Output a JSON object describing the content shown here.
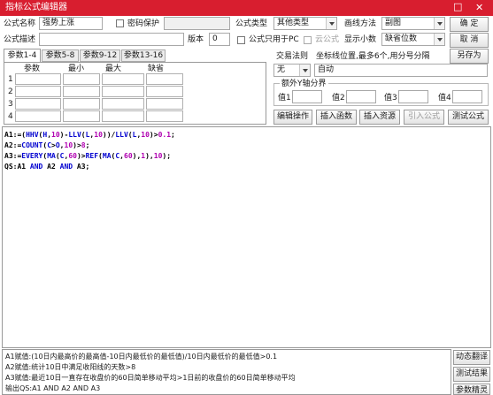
{
  "window": {
    "title": "指标公式编辑器",
    "min_glyph": "□",
    "close_glyph": "✕"
  },
  "header": {
    "name_label": "公式名称",
    "name_value": "强势上涨",
    "password_label": "密码保护",
    "type_label": "公式类型",
    "type_value": "其他类型",
    "draw_label": "画线方法",
    "draw_value": "副图",
    "desc_label": "公式描述",
    "desc_value": "",
    "version_label": "版本",
    "version_value": "0",
    "pc_only_label": "公式只用于PC",
    "cloud_label": "云公式",
    "decimals_label": "显示小数",
    "decimals_value": "缺省位数",
    "ok_label": "确 定",
    "cancel_label": "取 消",
    "saveas_label": "另存为"
  },
  "params": {
    "tabs": [
      "参数1-4",
      "参数5-8",
      "参数9-12",
      "参数13-16"
    ],
    "columns": [
      "参数",
      "最小",
      "最大",
      "缺省"
    ],
    "rows": [
      "1",
      "2",
      "3",
      "4"
    ]
  },
  "trade": {
    "rule_label": "交易法则",
    "rule_value": "无"
  },
  "coords": {
    "label": "坐标线位置,最多6个,用分号分隔",
    "value": "自动"
  },
  "yaxis": {
    "label": "额外Y轴分界",
    "fields": [
      "值1",
      "值2",
      "值3",
      "值4"
    ]
  },
  "actions": [
    "编辑操作",
    "插入函数",
    "插入资源",
    "引入公式",
    "测试公式"
  ],
  "code_lines": [
    [
      [
        "A1:=(",
        "o"
      ],
      [
        "HHV",
        "f"
      ],
      [
        "(",
        "o"
      ],
      [
        "H",
        "f"
      ],
      [
        ",",
        "o"
      ],
      [
        "10",
        "n"
      ],
      [
        ")-",
        "o"
      ],
      [
        "LLV",
        "f"
      ],
      [
        "(",
        "o"
      ],
      [
        "L",
        "f"
      ],
      [
        ",",
        "o"
      ],
      [
        "10",
        "n"
      ],
      [
        "))/",
        "o"
      ],
      [
        "LLV",
        "f"
      ],
      [
        "(",
        "o"
      ],
      [
        "L",
        "f"
      ],
      [
        ",",
        "o"
      ],
      [
        "10",
        "n"
      ],
      [
        ")>",
        "o"
      ],
      [
        "0.1",
        "n"
      ],
      [
        ";",
        "o"
      ]
    ],
    [
      [
        "A2:=",
        "o"
      ],
      [
        "COUNT",
        "f"
      ],
      [
        "(",
        "o"
      ],
      [
        "C",
        "f"
      ],
      [
        ">",
        "o"
      ],
      [
        "O",
        "f"
      ],
      [
        ",",
        "o"
      ],
      [
        "10",
        "n"
      ],
      [
        ")>",
        "o"
      ],
      [
        "8",
        "n"
      ],
      [
        ";",
        "o"
      ]
    ],
    [
      [
        "A3:=",
        "o"
      ],
      [
        "EVERY",
        "f"
      ],
      [
        "(",
        "o"
      ],
      [
        "MA",
        "f"
      ],
      [
        "(",
        "o"
      ],
      [
        "C",
        "f"
      ],
      [
        ",",
        "o"
      ],
      [
        "60",
        "n"
      ],
      [
        ")>",
        "o"
      ],
      [
        "REF",
        "f"
      ],
      [
        "(",
        "o"
      ],
      [
        "MA",
        "f"
      ],
      [
        "(",
        "o"
      ],
      [
        "C",
        "f"
      ],
      [
        ",",
        "o"
      ],
      [
        "60",
        "n"
      ],
      [
        "),",
        "o"
      ],
      [
        "1",
        "n"
      ],
      [
        "),",
        "o"
      ],
      [
        "10",
        "n"
      ],
      [
        ");",
        "o"
      ]
    ],
    [
      [
        "QS:A1 ",
        "o"
      ],
      [
        "AND",
        "k"
      ],
      [
        " A2 ",
        "o"
      ],
      [
        "AND",
        "k"
      ],
      [
        " A3;",
        "o"
      ]
    ]
  ],
  "info_lines": [
    "A1赋值:(10日内最高价的最高值-10日内最低价的最低值)/10日内最低价的最低值>0.1",
    "A2赋值:统计10日中满足收阳线的天数>8",
    "A3赋值:最近10日一直存在收盘价的60日简单移动平均>1日前的收盘价的60日简单移动平均",
    "输出QS:A1 AND A2 AND A3"
  ],
  "side_buttons": [
    "动态翻译",
    "测试结果",
    "参数精灵"
  ],
  "colors": {
    "titlebar": "#d81e2f",
    "code_func": "#0000d0",
    "code_num": "#b000b0"
  }
}
